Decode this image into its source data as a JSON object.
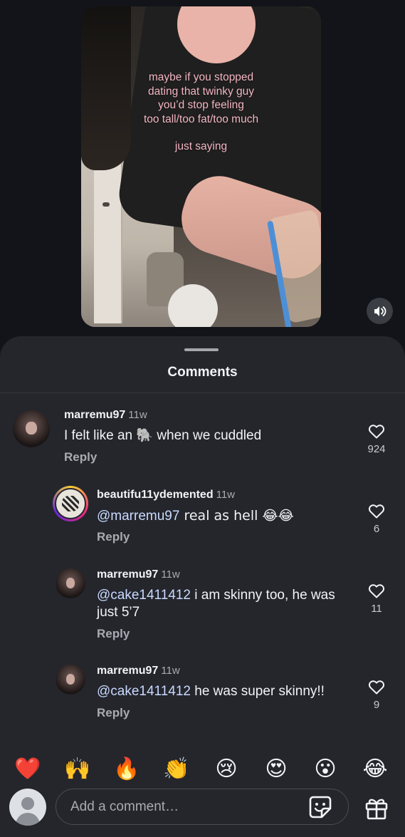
{
  "video": {
    "overlay_lines": [
      "maybe if you stopped",
      "dating that twinky guy",
      "you’d stop feeling",
      "too tall/too fat/too much"
    ],
    "overlay_tail": "just saying",
    "sound_icon": "speaker-icon"
  },
  "comments_sheet": {
    "title": "Comments",
    "comments": [
      {
        "user": "marremu97",
        "time": "11w",
        "text": "I felt like an 🐘 when we cuddled",
        "mention": "",
        "reply_label": "Reply",
        "likes": "924"
      },
      {
        "user": "beautifu11ydemented",
        "time": "11w",
        "mention": "@marremu97",
        "text": " real as hell 😂😂",
        "reply_label": "Reply",
        "likes": "6"
      },
      {
        "user": "marremu97",
        "time": "11w",
        "mention": "@cake1411412",
        "text": " i am skinny too, he was",
        "text2": "just 5’7",
        "reply_label": "Reply",
        "likes": "11"
      },
      {
        "user": "marremu97",
        "time": "11w",
        "mention": "@cake1411412",
        "text": " he was super skinny!!",
        "reply_label": "Reply",
        "likes": "9"
      }
    ]
  },
  "reactions": [
    "❤️",
    "🙌",
    "🔥",
    "👏",
    "😢",
    "😍",
    "😮",
    "😂"
  ],
  "composer": {
    "placeholder": "Add a comment…",
    "sticker_icon": "sticker-icon",
    "gift_icon": "gift-icon"
  },
  "colors": {
    "background": "#121419",
    "sheet": "#24262c",
    "overlay_text": "#f3b6c3",
    "mention": "#c9d9ff"
  }
}
